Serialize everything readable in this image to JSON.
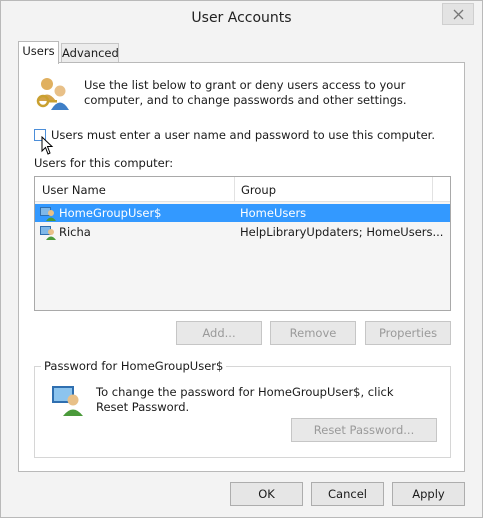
{
  "window": {
    "title": "User Accounts"
  },
  "tabs": [
    {
      "label": "Users",
      "selected": true
    },
    {
      "label": "Advanced",
      "selected": false
    }
  ],
  "users_tab": {
    "intro_text": "Use the list below to grant or deny users access to your computer, and to change passwords and other settings.",
    "require_login_checkbox": {
      "label": "Users must enter a user name and password to use this computer.",
      "checked": false
    },
    "users_label": "Users for this computer:",
    "table": {
      "columns": [
        "User Name",
        "Group"
      ],
      "rows": [
        {
          "name": "HomeGroupUser$",
          "group": "HomeUsers",
          "selected": true
        },
        {
          "name": "Richa",
          "group": "HelpLibraryUpdaters; HomeUsers...",
          "selected": false
        }
      ]
    },
    "buttons": {
      "add": "Add...",
      "remove": "Remove",
      "properties": "Properties"
    },
    "password_group": {
      "title": "Password for HomeGroupUser$",
      "text": "To change the password for HomeGroupUser$, click Reset Password.",
      "reset_button": "Reset Password..."
    }
  },
  "footer": {
    "ok": "OK",
    "cancel": "Cancel",
    "apply": "Apply"
  },
  "colors": {
    "selection": "#3399ff",
    "window_bg": "#f3f3f3",
    "checkbox_border": "#4c8ed9"
  },
  "icons": [
    "close-icon",
    "users-icon",
    "user-icon",
    "password-icon",
    "mouse-cursor-icon"
  ]
}
